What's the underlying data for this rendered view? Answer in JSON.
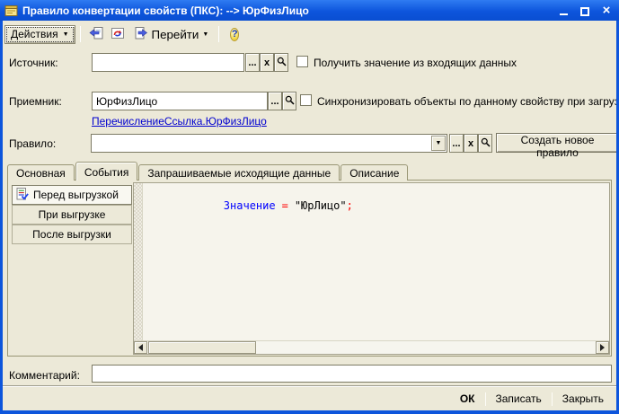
{
  "window": {
    "title": "Правило конвертации свойств (ПКС):  --> ЮрФизЛицо"
  },
  "toolbar": {
    "actions": "Действия",
    "goto": "Перейти",
    "help": "?"
  },
  "icons": {
    "dropdown": "▼",
    "close": "×",
    "ellipsis": "...",
    "clear": "x"
  },
  "form": {
    "source": {
      "label": "Источник:",
      "value": "",
      "checkbox_label": "Получить значение из входящих данных",
      "checked": false
    },
    "receiver": {
      "label": "Приемник:",
      "value": "ЮрФизЛицо",
      "checkbox_label": "Синхронизировать объекты по данному свойству при загрузке",
      "checked": false,
      "type_link": "ПеречислениеСсылка.ЮрФизЛицо"
    },
    "rule": {
      "label": "Правило:",
      "value": "",
      "create_button": "Создать новое правило"
    },
    "comment": {
      "label": "Комментарий:",
      "value": ""
    }
  },
  "tabs": [
    {
      "label": "Основная"
    },
    {
      "label": "События"
    },
    {
      "label": "Запрашиваемые исходящие данные"
    },
    {
      "label": "Описание"
    }
  ],
  "active_tab": "События",
  "events": [
    {
      "label": "Перед выгрузкой",
      "selected": true
    },
    {
      "label": "При выгрузке",
      "selected": false
    },
    {
      "label": "После выгрузки",
      "selected": false
    }
  ],
  "code": {
    "keyword": "Значение",
    "operator": "=",
    "string": "\"ЮрЛицо\"",
    "semicolon": ";",
    "colors": {
      "keyword": "#0000ff",
      "operator": "#ff0000",
      "string": "#000000"
    }
  },
  "footer": {
    "ok": "ОК",
    "save": "Записать",
    "close": "Закрыть"
  }
}
